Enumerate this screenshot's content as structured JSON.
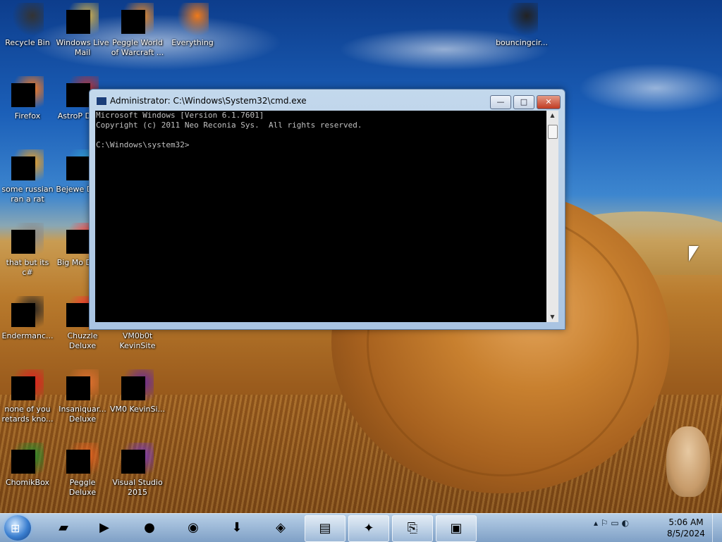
{
  "desktop_icons": [
    {
      "label": "Recycle Bin",
      "icon": "recycle-bin-icon"
    },
    {
      "label": "Windows Live Mail",
      "icon": "mail-icon"
    },
    {
      "label": "Peggle World of Warcraft ...",
      "icon": "peggle-icon"
    },
    {
      "label": "Everything",
      "icon": "search-icon"
    },
    {
      "label": "bouncingcir...",
      "icon": "document-icon"
    },
    {
      "label": "Firefox",
      "icon": "firefox-icon"
    },
    {
      "label": "AstroP Delux",
      "icon": "game-icon"
    },
    {
      "label": "some russian ran a rat",
      "icon": "app-icon"
    },
    {
      "label": "Bejewe Delux",
      "icon": "game-icon"
    },
    {
      "label": "that but its c#",
      "icon": "app-icon"
    },
    {
      "label": "Big Mo Delux",
      "icon": "game-icon"
    },
    {
      "label": "Endermanc...",
      "icon": "app-icon"
    },
    {
      "label": "Chuzzle Deluxe",
      "icon": "game-icon"
    },
    {
      "label": "VM0b0t KevinSite",
      "icon": "app-icon"
    },
    {
      "label": "none of you retards kno...",
      "icon": "app-icon"
    },
    {
      "label": "Insaniquar... Deluxe",
      "icon": "game-icon"
    },
    {
      "label": "VM0 KevinSi...",
      "icon": "app-icon"
    },
    {
      "label": "ChomikBox",
      "icon": "app-icon"
    },
    {
      "label": "Peggle Deluxe",
      "icon": "peggle-icon"
    },
    {
      "label": "Visual Studio 2015",
      "icon": "visual-studio-icon"
    }
  ],
  "cmd_window": {
    "title": "Administrator: C:\\Windows\\System32\\cmd.exe",
    "min_label": "—",
    "max_label": "□",
    "close_label": "✕",
    "lines": [
      "Microsoft Windows [Version 6.1.7601]",
      "Copyright (c) 2011 Neo Reconia Sys.  All rights reserved.",
      "",
      "C:\\Windows\\system32>"
    ]
  },
  "taskbar": {
    "items": [
      {
        "name": "terminal",
        "glyph": "▰",
        "active": false
      },
      {
        "name": "media-player",
        "glyph": "▶",
        "active": false
      },
      {
        "name": "globe",
        "glyph": "●",
        "active": false
      },
      {
        "name": "firefox",
        "glyph": "◉",
        "active": false
      },
      {
        "name": "internet-download-manager",
        "glyph": "⬇",
        "active": false
      },
      {
        "name": "virtualbox",
        "glyph": "◈",
        "active": false
      },
      {
        "name": "file-explorer",
        "glyph": "▤",
        "active": true
      },
      {
        "name": "network-tool",
        "glyph": "✦",
        "active": true
      },
      {
        "name": "remote-app",
        "glyph": "⎘",
        "active": true
      },
      {
        "name": "cmd",
        "glyph": "▣",
        "active": true
      }
    ],
    "tray_glyphs": "▴  ⚐  ▭  ◐",
    "time": "5:06 AM",
    "date": "8/5/2024"
  },
  "colors": {
    "console_bg": "#000000",
    "console_text": "#c0c0c0",
    "close_button": "#c03b22"
  }
}
